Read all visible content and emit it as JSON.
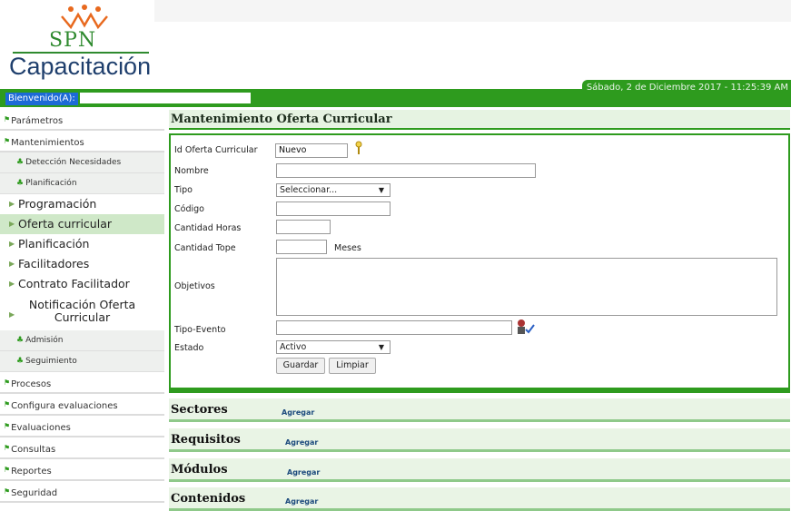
{
  "header": {
    "logo_text": "SPN",
    "app_title": "Capacitación",
    "welcome": "Bienvenido(A):",
    "date": "Sábado, 2 de Diciembre 2017 - 11:25:39 AM"
  },
  "sidebar": {
    "parametros": "Parámetros",
    "mantenimientos": "Mantenimientos",
    "deteccion": "Detección Necesidades",
    "planificacion_group": "Planificación",
    "programacion": "Programación",
    "oferta": "Oferta curricular",
    "planificacion": "Planificación",
    "facilitadores": "Facilitadores",
    "contrato": "Contrato Facilitador",
    "notificacion": "Notificación Oferta Curricular",
    "admision": "Admisión",
    "seguimiento": "Seguimiento",
    "procesos": "Procesos",
    "configura": "Configura evaluaciones",
    "evaluaciones": "Evaluaciones",
    "consultas": "Consultas",
    "reportes": "Reportes",
    "seguridad": "Seguridad"
  },
  "form": {
    "title": "Mantenimiento  Oferta Curricular",
    "id_label": "Id Oferta Curricular",
    "id_value": "Nuevo",
    "nombre_label": "Nombre",
    "tipo_label": "Tipo",
    "tipo_value": "Seleccionar...",
    "codigo_label": "Código",
    "horas_label": "Cantidad Horas",
    "tope_label": "Cantidad Tope",
    "meses_label": "Meses",
    "objetivos_label": "Objetivos",
    "tipo_evento_label": "Tipo-Evento",
    "estado_label": "Estado",
    "estado_value": "Activo",
    "guardar": "Guardar",
    "limpiar": "Limpiar"
  },
  "sections": {
    "sectores": "Sectores",
    "requisitos": "Requisitos",
    "modulos": "Módulos",
    "contenidos": "Contenidos",
    "agregar": "Agregar"
  },
  "colors": {
    "brand_green": "#2e9b1e",
    "brand_blue": "#1f3f6d"
  }
}
